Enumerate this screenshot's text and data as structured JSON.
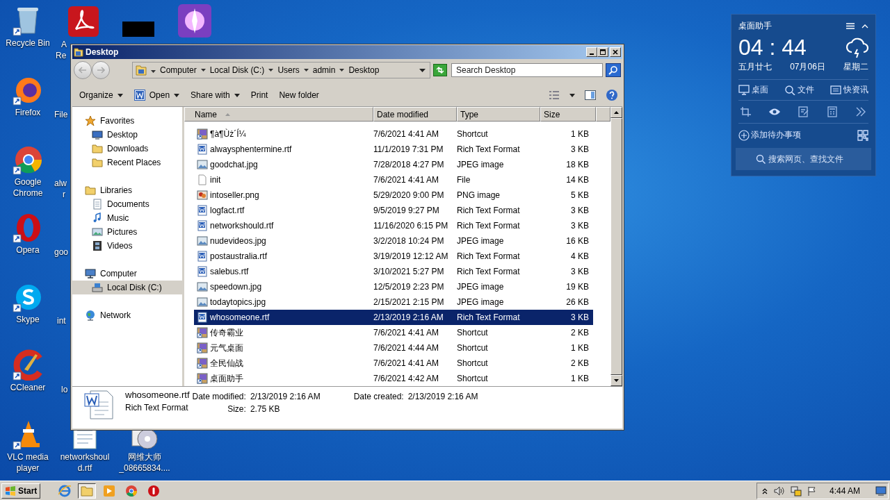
{
  "desktop": {
    "icons": [
      {
        "label": "Recycle Bin",
        "kind": "recycle"
      },
      {
        "label": "Firefox",
        "kind": "firefox"
      },
      {
        "label": "Google Chrome",
        "kind": "chrome"
      },
      {
        "label": "Opera",
        "kind": "opera"
      },
      {
        "label": "Skype",
        "kind": "skype"
      },
      {
        "label": "CCleaner",
        "kind": "ccleaner"
      },
      {
        "label": "VLC media player",
        "kind": "vlc"
      }
    ],
    "partial_labels": [
      "A",
      "Re",
      "File",
      "alw",
      "r",
      "goo",
      "int",
      "lo"
    ],
    "bottom_icons": [
      {
        "label": "networkshoul d.rtf",
        "kind": "document"
      },
      {
        "label": "网维大师 _08665834....",
        "kind": "disc"
      }
    ]
  },
  "window": {
    "title": "Desktop",
    "breadcrumbs": [
      "Computer",
      "Local Disk (C:)",
      "Users",
      "admin",
      "Desktop"
    ],
    "search": {
      "placeholder": "Search Desktop"
    },
    "toolbar": [
      {
        "label": "Organize",
        "dropdown": true,
        "kind": "text"
      },
      {
        "label": "Open",
        "dropdown": true,
        "kind": "word"
      },
      {
        "label": "Share with",
        "dropdown": true,
        "kind": "text"
      },
      {
        "label": "Print",
        "dropdown": false,
        "kind": "text"
      },
      {
        "label": "New folder",
        "dropdown": false,
        "kind": "text"
      }
    ],
    "sidebar": {
      "items": [
        {
          "label": "Favorites",
          "kind": "star",
          "selected": false,
          "children": [
            {
              "label": "Desktop",
              "kind": "desktop",
              "selected": false
            },
            {
              "label": "Downloads",
              "kind": "folder",
              "selected": false
            },
            {
              "label": "Recent Places",
              "kind": "folder",
              "selected": false
            }
          ]
        },
        {
          "label": "Libraries",
          "kind": "folder",
          "selected": false,
          "children": [
            {
              "label": "Documents",
              "kind": "page",
              "selected": false
            },
            {
              "label": "Music",
              "kind": "note",
              "selected": false
            },
            {
              "label": "Pictures",
              "kind": "image",
              "selected": false
            },
            {
              "label": "Videos",
              "kind": "film",
              "selected": false
            }
          ]
        },
        {
          "label": "Computer",
          "kind": "computer",
          "selected": false,
          "children": [
            {
              "label": "Local Disk (C:)",
              "kind": "disk",
              "selected": true
            }
          ]
        },
        {
          "label": "Network",
          "kind": "globe",
          "selected": false
        }
      ]
    },
    "table": {
      "columns": [
        "Name",
        "Date modified",
        "Type",
        "Size"
      ],
      "rows": [
        {
          "name": "¶à¶Ùż´Í¼",
          "date": "7/6/2021 4:41 AM",
          "type": "Shortcut",
          "size": "1 KB",
          "kind": "shortcut",
          "selected": false
        },
        {
          "name": "alwaysphentermine.rtf",
          "date": "11/1/2019 7:31 PM",
          "type": "Rich Text Format",
          "size": "3 KB",
          "kind": "rtf",
          "selected": false
        },
        {
          "name": "goodchat.jpg",
          "date": "7/28/2018 4:27 PM",
          "type": "JPEG image",
          "size": "18 KB",
          "kind": "image",
          "selected": false
        },
        {
          "name": "init",
          "date": "7/6/2021 4:41 AM",
          "type": "File",
          "size": "14 KB",
          "kind": "file",
          "selected": false
        },
        {
          "name": "intoseller.png",
          "date": "5/29/2020 9:00 PM",
          "type": "PNG image",
          "size": "5 KB",
          "kind": "png",
          "selected": false
        },
        {
          "name": "logfact.rtf",
          "date": "9/5/2019 9:27 PM",
          "type": "Rich Text Format",
          "size": "3 KB",
          "kind": "rtf",
          "selected": false
        },
        {
          "name": "networkshould.rtf",
          "date": "11/16/2020 6:15 PM",
          "type": "Rich Text Format",
          "size": "3 KB",
          "kind": "rtf",
          "selected": false
        },
        {
          "name": "nudevideos.jpg",
          "date": "3/2/2018 10:24 PM",
          "type": "JPEG image",
          "size": "16 KB",
          "kind": "image",
          "selected": false
        },
        {
          "name": "postaustralia.rtf",
          "date": "3/19/2019 12:12 AM",
          "type": "Rich Text Format",
          "size": "4 KB",
          "kind": "rtf",
          "selected": false
        },
        {
          "name": "salebus.rtf",
          "date": "3/10/2021 5:27 PM",
          "type": "Rich Text Format",
          "size": "3 KB",
          "kind": "rtf",
          "selected": false
        },
        {
          "name": "speedown.jpg",
          "date": "12/5/2019 2:23 PM",
          "type": "JPEG image",
          "size": "19 KB",
          "kind": "image",
          "selected": false
        },
        {
          "name": "todaytopics.jpg",
          "date": "2/15/2021 2:15 PM",
          "type": "JPEG image",
          "size": "26 KB",
          "kind": "image",
          "selected": false
        },
        {
          "name": "whosomeone.rtf",
          "date": "2/13/2019 2:16 AM",
          "type": "Rich Text Format",
          "size": "3 KB",
          "kind": "rtf",
          "selected": true
        },
        {
          "name": "传奇霸业",
          "date": "7/6/2021 4:41 AM",
          "type": "Shortcut",
          "size": "2 KB",
          "kind": "shortcut",
          "selected": false
        },
        {
          "name": "元气桌面",
          "date": "7/6/2021 4:44 AM",
          "type": "Shortcut",
          "size": "1 KB",
          "kind": "shortcut",
          "selected": false
        },
        {
          "name": "全民仙战",
          "date": "7/6/2021 4:41 AM",
          "type": "Shortcut",
          "size": "2 KB",
          "kind": "shortcut",
          "selected": false
        },
        {
          "name": "桌面助手",
          "date": "7/6/2021 4:42 AM",
          "type": "Shortcut",
          "size": "1 KB",
          "kind": "shortcut",
          "selected": false
        }
      ]
    },
    "details": {
      "name": "whosomeone.rtf",
      "type": "Rich Text Format",
      "modified_label": "Date modified:",
      "modified": "2/13/2019 2:16 AM",
      "size_label": "Size:",
      "size": "2.75 KB",
      "created_label": "Date created:",
      "created": "2/13/2019 2:16 AM"
    }
  },
  "widget": {
    "title": "桌面助手",
    "time": "04 : 44",
    "lunar_date": "五月廿七",
    "date": "07月06日",
    "weekday": "星期二",
    "links": [
      {
        "label": "桌面",
        "kind": "monitor"
      },
      {
        "label": "文件",
        "kind": "search"
      },
      {
        "label": "快资讯",
        "kind": "news"
      }
    ],
    "tools": [
      {
        "kind": "crop"
      },
      {
        "kind": "eye"
      },
      {
        "kind": "note"
      },
      {
        "kind": "calculator"
      },
      {
        "kind": "more"
      }
    ],
    "todo": "添加待办事项",
    "search_placeholder": "搜索网页、查找文件"
  },
  "taskbar": {
    "start": "Start",
    "apps": [
      {
        "kind": "ie",
        "selected": false
      },
      {
        "kind": "explorer",
        "selected": true
      },
      {
        "kind": "media",
        "selected": false
      },
      {
        "kind": "chrome",
        "selected": false
      },
      {
        "kind": "opera",
        "selected": false
      }
    ],
    "clock": "4:44 AM"
  }
}
